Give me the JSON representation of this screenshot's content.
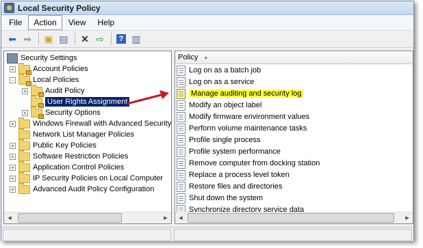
{
  "window": {
    "title": "Local Security Policy"
  },
  "menu": [
    {
      "label": "File",
      "active": false
    },
    {
      "label": "Action",
      "active": true
    },
    {
      "label": "View",
      "active": false
    },
    {
      "label": "Help",
      "active": false
    }
  ],
  "toolbar": {
    "buttons": [
      "back-icon",
      "forward-icon",
      "up-folder-icon",
      "show-hide-tree-icon",
      "delete-icon",
      "export-list-icon",
      "help-icon",
      "properties-icon"
    ]
  },
  "tree": {
    "root": "Security Settings",
    "items": [
      {
        "label": "Account Policies",
        "expander": "+"
      },
      {
        "label": "Local Policies",
        "expander": "-"
      },
      {
        "label": "Audit Policy",
        "expander": "+"
      },
      {
        "label": "User Rights Assignment",
        "expander": "",
        "selected": true
      },
      {
        "label": "Security Options",
        "expander": "+"
      },
      {
        "label": "Windows Firewall with Advanced Security",
        "expander": "+"
      },
      {
        "label": "Network List Manager Policies",
        "expander": ""
      },
      {
        "label": "Public Key Policies",
        "expander": "+"
      },
      {
        "label": "Software Restriction Policies",
        "expander": "+"
      },
      {
        "label": "Application Control Policies",
        "expander": "+"
      },
      {
        "label": "IP Security Policies on Local Computer",
        "expander": "+"
      },
      {
        "label": "Advanced Audit Policy Configuration",
        "expander": "+"
      }
    ]
  },
  "list": {
    "column_header": "Policy",
    "sort_indicator": "▲",
    "items": [
      {
        "label": "Log on as a batch job"
      },
      {
        "label": "Log on as a service"
      },
      {
        "label": "Manage auditing and security log",
        "highlighted": true
      },
      {
        "label": "Modify an object label"
      },
      {
        "label": "Modify firmware environment values"
      },
      {
        "label": "Perform volume maintenance tasks"
      },
      {
        "label": "Profile single process"
      },
      {
        "label": "Profile system performance"
      },
      {
        "label": "Remove computer from docking station"
      },
      {
        "label": "Replace a process level token"
      },
      {
        "label": "Restore files and directories"
      },
      {
        "label": "Shut down the system"
      },
      {
        "label": "Synchronize directory service data"
      }
    ]
  },
  "colors": {
    "selection": "#0a246a",
    "highlight": "#ffff3b",
    "annotation_arrow": "#c8171e"
  }
}
